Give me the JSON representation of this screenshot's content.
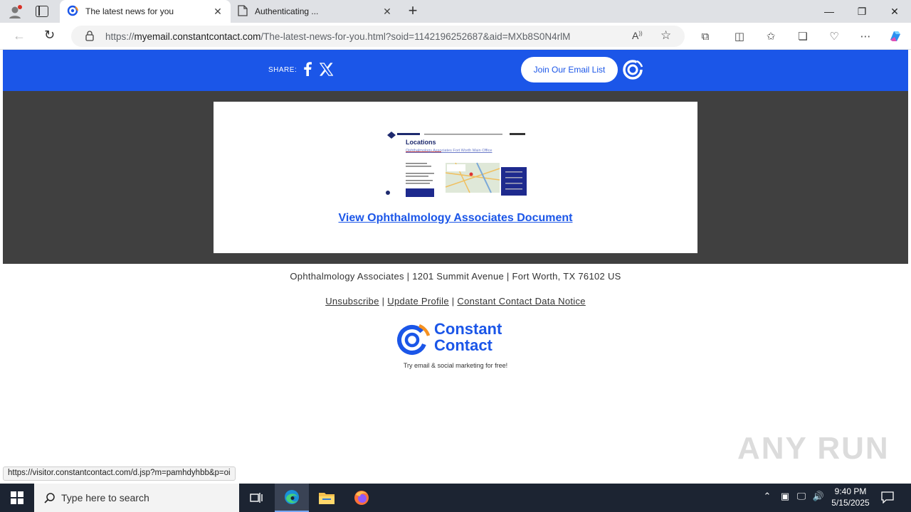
{
  "browser": {
    "tabs": [
      {
        "label": "The latest news for you"
      },
      {
        "label": "Authenticating ..."
      }
    ],
    "url_prefix": "https://",
    "url_host": "myemail.constantcontact.com",
    "url_path": "/The-latest-news-for-you.html?soid=1142196252687&aid=MXb8S0N4rlM",
    "status_url": "https://visitor.constantcontact.com/d.jsp?m=pamhdyhbb&p=oi"
  },
  "email": {
    "share_label": "SHARE:",
    "join_button": "Join Our Email List",
    "thumbnail_title": "Locations",
    "thumbnail_link": "Ophthalmology Associates Fort Worth Main Office",
    "view_link": "View Ophthalmology Associates Document",
    "address": "Ophthalmology Associates | 1201 Summit Avenue | Fort Worth, TX 76102 US",
    "footer_links": {
      "unsubscribe": "Unsubscribe",
      "update_profile": "Update Profile",
      "data_notice": "Constant Contact Data Notice",
      "separator": "|"
    },
    "cc_logo_line1": "Constant",
    "cc_logo_line2": "Contact",
    "cc_tagline": "Try email & social marketing for free!"
  },
  "watermark": "ANY RUN",
  "taskbar": {
    "search_placeholder": "Type here to search",
    "time": "9:40 PM",
    "date": "5/15/2025"
  },
  "colors": {
    "brand_blue": "#1b56e8",
    "banner_bg": "#1b56e8",
    "page_gray": "#404040",
    "cc_orange": "#f59120"
  }
}
